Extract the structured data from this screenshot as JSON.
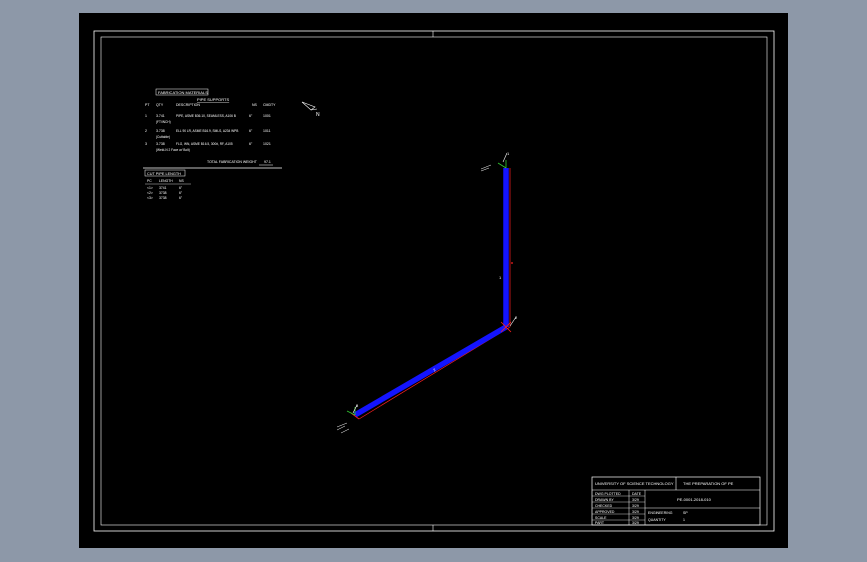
{
  "drawing": {
    "background": "#000000",
    "viewport_background": "#8d98a8",
    "pipe_color": "#1414ff",
    "dimension_color": "#ff2020",
    "line_color": "#ffffff",
    "marker_color": "#33cc33",
    "north_label": "N",
    "node_labels": {
      "top": "1",
      "mid": "2",
      "end": "3"
    },
    "pipe_labels": {
      "vertical": "1",
      "diagonal": "2"
    }
  },
  "materials": {
    "heading": "FABRICATION MATERIALS",
    "subheading": "PIPE SUPPORTS",
    "columns": [
      "PT",
      "QTY",
      "DESCRIPTION",
      "NS",
      "CMDTY"
    ],
    "rows": [
      {
        "pt": "1",
        "qty": "3.741",
        "desc": "PIPE, ASME B36.10, SEAMLESS, A106 B",
        "ns": "6\"",
        "code": "1001",
        "extra": "(FT/INCH)"
      },
      {
        "pt": "2",
        "qty": "3.738",
        "desc": "ELL 90 LR, ASME B16.9, SMLS, A234 WPB",
        "ns": "6\"",
        "code": "1011",
        "extra": "(Cuttable)"
      },
      {
        "pt": "3",
        "qty": "3.738",
        "desc": "FLG, WN, ASME B16.5, 300#, RF, A105",
        "ns": "6\"",
        "code": "1021",
        "extra": "(Weld-N 2 Face w/ Bolt)"
      }
    ],
    "total_label": "TOTAL FABRICATION WEIGHT",
    "total_value": "97.1"
  },
  "cut_pipe": {
    "heading": "CUT PIPE LENGTH",
    "columns": [
      "PC",
      "LENGTH",
      "NS"
    ],
    "rows": [
      [
        "<1>",
        "3741",
        "6\""
      ],
      [
        "<2>",
        "3738",
        "6\""
      ],
      [
        "<3>",
        "3738",
        "6\""
      ]
    ]
  },
  "title_block": {
    "university": "UNIVERSITY OF SCIENCE TECHNOLOGY",
    "project": "THE PREPARATION OF PE",
    "drawing_no": "PE-0001-2018-010",
    "rows": [
      {
        "label": "DWG PLOTTED",
        "value": "DATE"
      },
      {
        "label": "DRAWN BY",
        "value": "3/29"
      },
      {
        "label": "CHECKED",
        "value": "3/29"
      },
      {
        "label": "APPROVED",
        "value": "3/29"
      },
      {
        "label": "SCALE",
        "value": "3/29"
      },
      {
        "label": "PART",
        "value": "3/29"
      }
    ],
    "software_label": "ENGINEERING",
    "software_value": "SP",
    "quantity_label": "QUANTITY",
    "quantity_value": "1"
  }
}
